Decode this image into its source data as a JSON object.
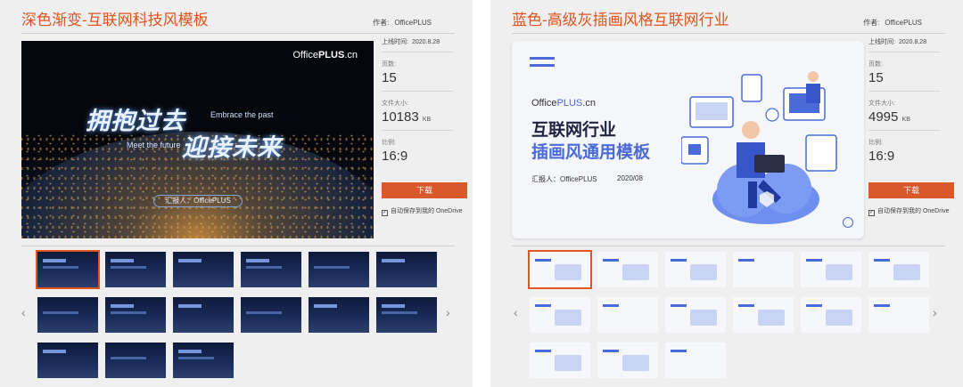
{
  "left": {
    "title": "深色渐变-互联网科技风模板",
    "author_label": "作者:",
    "author": "OfficePLUS",
    "preview": {
      "brand_prefix": "Office",
      "brand_bold": "PLUS",
      "brand_suffix": ".cn",
      "heading1": "拥抱过去",
      "heading1_en": "Embrace the past",
      "heading2_en": "Meet the future",
      "heading2": "迎接未来",
      "reporter": "汇报人：OfficePLUS"
    },
    "info": {
      "upload_label": "上线时间:",
      "upload_date": "2020.8.28",
      "pages_label": "页数:",
      "pages": "15",
      "size_label": "文件大小:",
      "size": "10183",
      "size_unit": "KB",
      "ratio_label": "比例:",
      "ratio": "16:9"
    },
    "download": "下载",
    "onedrive": "自动保存到我的 OneDrive"
  },
  "right": {
    "title": "蓝色-高级灰插画风格互联网行业",
    "author_label": "作者:",
    "author": "OfficePLUS",
    "preview": {
      "brand_prefix": "Office",
      "brand_bold": "PLUS",
      "brand_suffix": ".cn",
      "heading1": "互联网行业",
      "heading2": "插画风通用模板",
      "reporter": "汇报人：OfficePLUS",
      "date": "2020/08"
    },
    "info": {
      "upload_label": "上线时间:",
      "upload_date": "2020.8.28",
      "pages_label": "页数:",
      "pages": "15",
      "size_label": "文件大小:",
      "size": "4995",
      "size_unit": "KB",
      "ratio_label": "比例:",
      "ratio": "16:9"
    },
    "download": "下载",
    "onedrive": "自动保存到我的 OneDrive"
  },
  "nav": {
    "prev": "‹",
    "next": "›"
  },
  "colors": {
    "accent": "#e0541f",
    "download_bg": "#d9582c",
    "brand_blue": "#4a6ad8"
  }
}
